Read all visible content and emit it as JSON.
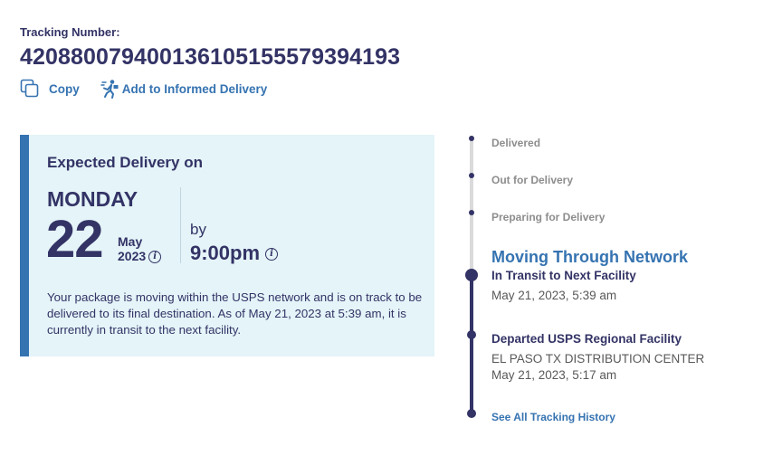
{
  "tracking": {
    "label": "Tracking Number:",
    "number": "420880079400136105155579394193"
  },
  "actions": {
    "copy": {
      "label": "Copy",
      "icon": "copy-icon"
    },
    "informed_delivery": {
      "label": "Add to Informed Delivery",
      "icon": "informed-delivery-icon"
    }
  },
  "delivery": {
    "title": "Expected Delivery on",
    "day": "MONDAY",
    "date": "22",
    "month": "May",
    "year": "2023",
    "by": "by",
    "time": "9:00pm",
    "description": "Your package is moving within the USPS network and is on track to be delivered to its final destination. As of May 21, 2023 at 5:39 am, it is currently in transit to the next facility."
  },
  "timeline": {
    "steps": [
      {
        "label": "Delivered"
      },
      {
        "label": "Out for Delivery"
      },
      {
        "label": "Preparing for Delivery"
      }
    ],
    "current_status": "Moving Through Network",
    "events": [
      {
        "title": "In Transit to Next Facility",
        "location": "",
        "timestamp": "May 21, 2023, 5:39 am"
      },
      {
        "title": "Departed USPS Regional Facility",
        "location": "EL PASO TX DISTRIBUTION CENTER",
        "timestamp": "May 21, 2023, 5:17 am"
      }
    ],
    "history_link": "See All Tracking History"
  },
  "colors": {
    "navy": "#333366",
    "link_blue": "#3573b1",
    "card_background": "#e4f4f8",
    "inactive_gray": "#8d8d8d"
  }
}
